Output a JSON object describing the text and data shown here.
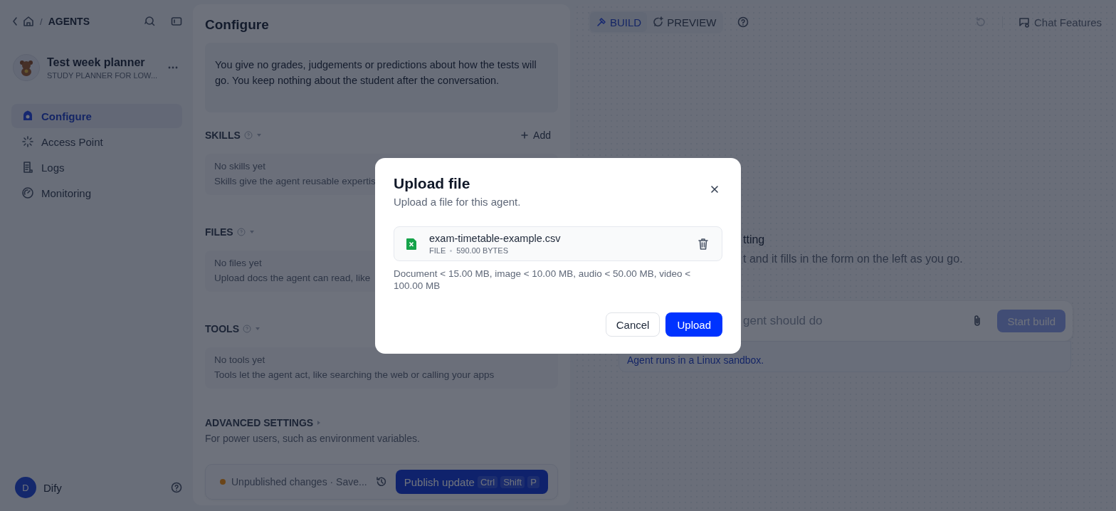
{
  "sidebar": {
    "breadcrumb_separator": "/",
    "breadcrumb": "AGENTS",
    "agent": {
      "name": "Test week planner",
      "subtitle": "STUDY PLANNER FOR LOW..."
    },
    "nav": [
      {
        "label": "Configure",
        "selected": true
      },
      {
        "label": "Access Point",
        "selected": false
      },
      {
        "label": "Logs",
        "selected": false
      },
      {
        "label": "Monitoring",
        "selected": false
      }
    ],
    "user": {
      "initial": "D",
      "name": "Dify"
    }
  },
  "config_panel": {
    "title": "Configure",
    "prompt": "You give no grades, judgements or predictions about how the tests will go. You keep nothing about the student after the conversation.",
    "sections": [
      {
        "title": "SKILLS",
        "action": "Add",
        "empty_title": "No skills yet",
        "empty_text": "Skills give the agent reusable expertis"
      },
      {
        "title": "FILES",
        "empty_title": "No files yet",
        "empty_text": "Upload docs the agent can read, like"
      },
      {
        "title": "TOOLS",
        "empty_title": "No tools yet",
        "empty_text": "Tools let the agent act, like searching the web or calling your apps"
      }
    ],
    "advanced": {
      "title": "ADVANCED SETTINGS",
      "text": "For power users, such as environment variables."
    },
    "footer": {
      "status": "Unpublished changes · Save...",
      "publish": "Publish update",
      "shortcut": [
        "Ctrl",
        "Shift",
        "P"
      ]
    }
  },
  "builder": {
    "tabs": [
      {
        "label": "BUILD",
        "selected": true
      },
      {
        "label": "PREVIEW",
        "selected": false
      }
    ],
    "chat_features": "Chat Features",
    "heading_fragment": "tting",
    "text_fragment": "t and it fills in the form on the left as you go.",
    "placeholder": "gent should do",
    "start_button": {
      "label": "Start build",
      "disabled": true
    },
    "note": "Agent runs in a Linux sandbox."
  },
  "dialog": {
    "title": "Upload file",
    "subtitle": "Upload a file for this agent.",
    "file": {
      "name": "exam-timetable-example.csv",
      "type": "FILE",
      "size": "590.00 BYTES"
    },
    "limits": "Document < 15.00 MB, image < 10.00 MB, audio < 50.00 MB, video < 100.00 MB",
    "buttons": [
      {
        "label": "Cancel",
        "kind": "secondary"
      },
      {
        "label": "Upload",
        "kind": "primary"
      }
    ]
  }
}
